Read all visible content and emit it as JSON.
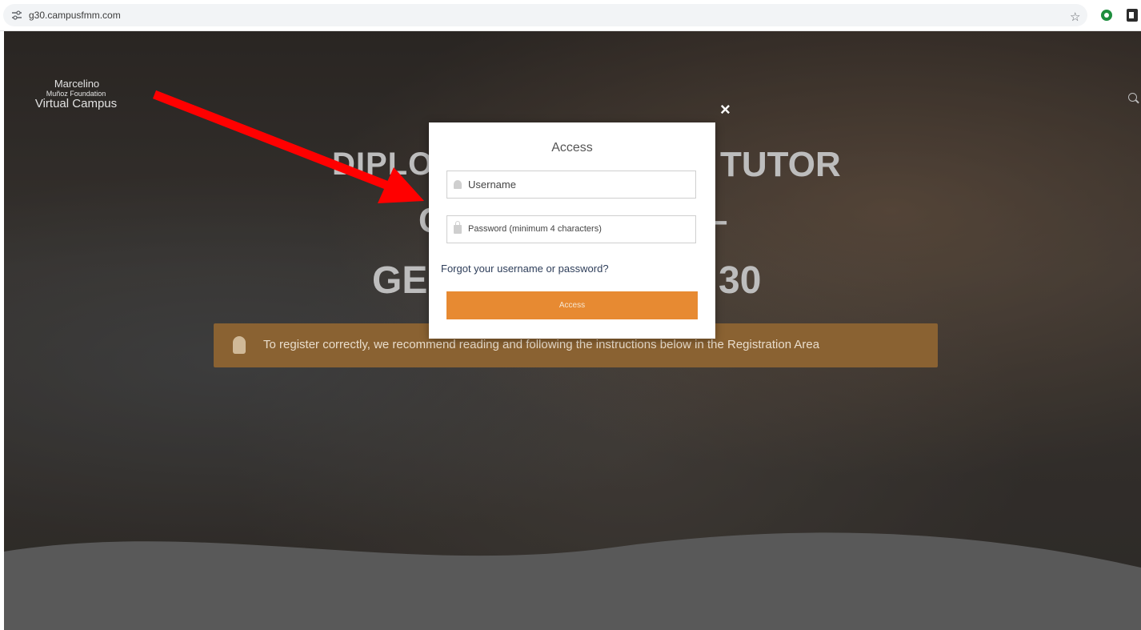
{
  "browser": {
    "url": "g30.campusfmm.com"
  },
  "site": {
    "logo_line1": "Marcelino",
    "logo_line2": "Muñoz Foundation",
    "logo_line3": "Virtual Campus"
  },
  "hero": {
    "headline_left": "DIPLOMA",
    "headline_right": "TUTOR",
    "headline_line2_left": "C",
    "headline_line2_right": "–",
    "headline_line3_left": "GE",
    "headline_line3_right": "30",
    "banner_text": "To register correctly, we recommend reading and following the instructions below in the Registration Area"
  },
  "modal": {
    "title": "Access",
    "username_placeholder": "Username",
    "password_placeholder": "Password (minimum 4 characters)",
    "forgot_link": "Forgot your username or password?",
    "access_button": "Access",
    "close_symbol": "×"
  },
  "colors": {
    "accent_orange": "#e78a32",
    "banner_brown": "#8a6232",
    "annotation_red": "#ff0000"
  },
  "icons": [
    "site-settings-icon",
    "bookmark-star-icon",
    "extension-icon",
    "side-panel-icon",
    "search-icon",
    "user-icon",
    "lock-icon",
    "pencil-icon",
    "close-icon",
    "red-arrow-annotation"
  ]
}
